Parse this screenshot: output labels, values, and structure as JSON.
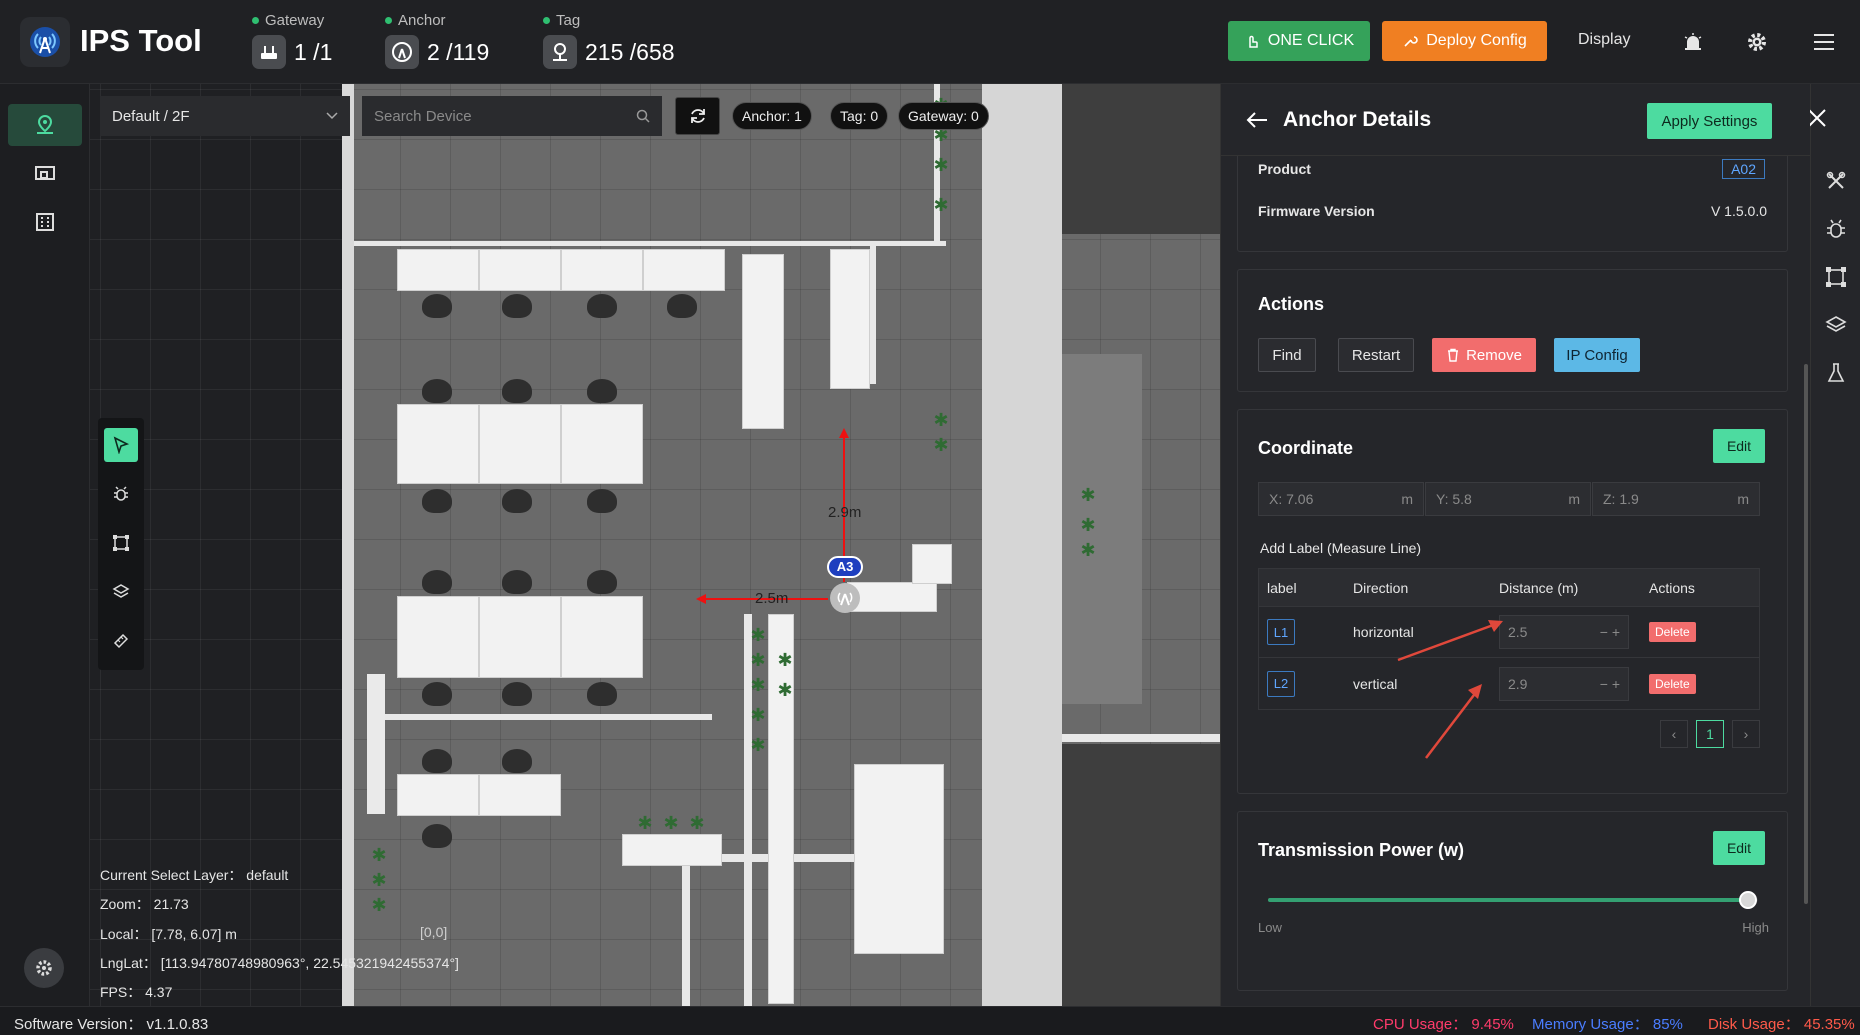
{
  "app": {
    "title": "IPS Tool"
  },
  "header": {
    "stats": [
      {
        "label": "Gateway",
        "value": "1 /1",
        "icon": "gateway-icon"
      },
      {
        "label": "Anchor",
        "value": "2 /119",
        "icon": "anchor-icon"
      },
      {
        "label": "Tag",
        "value": "215 /658",
        "icon": "tag-icon"
      }
    ],
    "one_click_label": "ONE CLICK",
    "deploy_label": "Deploy Config",
    "display_label": "Display",
    "colors": {
      "one_click": "#35a25a",
      "deploy": "#f07f22",
      "accent": "#4ddba0"
    }
  },
  "map": {
    "floor_select": "Default / 2F",
    "search_placeholder": "Search Device",
    "pills": {
      "anchor": "Anchor: 1",
      "tag": "Tag: 0",
      "gateway": "Gateway: 0"
    },
    "anchor_label": "A3",
    "measure_vertical": "2.9m",
    "measure_horizontal": "2.5m",
    "origin": "[0,0]",
    "info": {
      "layer": "Current Select Layer： default",
      "zoom": "Zoom： 21.73",
      "local": "Local： [7.78, 6.07] m",
      "lnglat": "LngLat： [113.94780748980963°, 22.545321942455374°]",
      "fps": "FPS： 4.37"
    }
  },
  "panel": {
    "title": "Anchor Details",
    "apply_label": "Apply Settings",
    "product_key": "Product",
    "product_value": "A02",
    "firmware_key": "Firmware Version",
    "firmware_value": "V 1.5.0.0",
    "actions": {
      "title": "Actions",
      "find": "Find",
      "restart": "Restart",
      "remove": "Remove",
      "ip_config": "IP Config"
    },
    "coordinate": {
      "title": "Coordinate",
      "edit_label": "Edit",
      "x": "X: 7.06",
      "y": "Y: 5.8",
      "z": "Z: 1.9",
      "unit": "m",
      "measure_title": "Add Label (Measure Line)",
      "columns": [
        "label",
        "Direction",
        "Distance (m)",
        "Actions"
      ],
      "rows": [
        {
          "label": "L1",
          "direction": "horizontal",
          "distance": "2.5",
          "action": "Delete"
        },
        {
          "label": "L2",
          "direction": "vertical",
          "distance": "2.9",
          "action": "Delete"
        }
      ],
      "page": "1"
    },
    "power": {
      "title": "Transmission Power (w)",
      "edit_label": "Edit",
      "low": "Low",
      "high": "High",
      "level": 0.98
    }
  },
  "status": {
    "version": "Software Version： v1.1.0.83",
    "cpu": "CPU Usage： 9.45%",
    "memory": "Memory Usage： 85%",
    "disk": "Disk Usage： 45.35%",
    "colors": {
      "cpu": "#ff3b6b",
      "memory": "#4a7dff",
      "disk": "#ff5a4a"
    }
  }
}
